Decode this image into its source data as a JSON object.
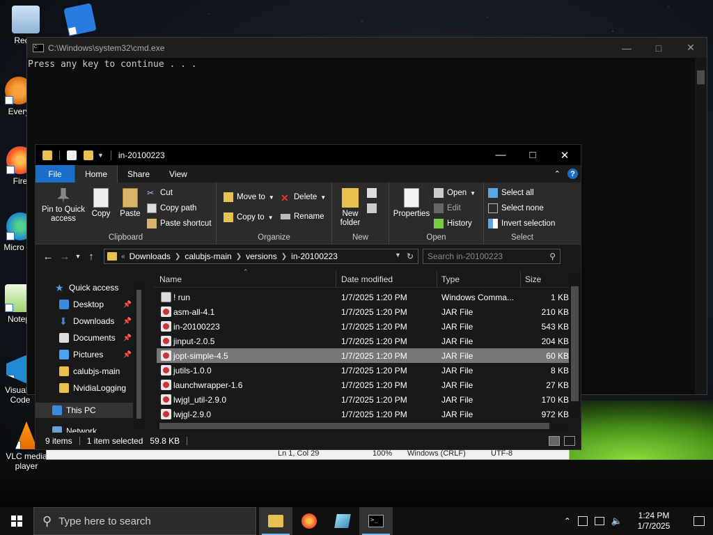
{
  "desktop": {
    "icons": [
      {
        "label": "Recyc"
      },
      {
        "label": "Every"
      },
      {
        "label": "Fire"
      },
      {
        "label": "Micro Ed"
      },
      {
        "label": "Notep"
      },
      {
        "label": "Visual S Code"
      },
      {
        "label": "VLC media player"
      }
    ]
  },
  "cmd": {
    "title": "C:\\Windows\\system32\\cmd.exe",
    "output": "Press any key to continue . . ."
  },
  "notepad_status": {
    "position": "Ln 1, Col 29",
    "zoom": "100%",
    "line_ending": "Windows (CRLF)",
    "encoding": "UTF-8"
  },
  "explorer": {
    "title": "in-20100223",
    "tabs": {
      "file": "File",
      "home": "Home",
      "share": "Share",
      "view": "View"
    },
    "ribbon": {
      "clipboard": {
        "label": "Clipboard",
        "pin": "Pin to Quick access",
        "copy": "Copy",
        "paste": "Paste",
        "cut": "Cut",
        "copy_path": "Copy path",
        "paste_shortcut": "Paste shortcut"
      },
      "organize": {
        "label": "Organize",
        "move_to": "Move to",
        "copy_to": "Copy to",
        "delete": "Delete",
        "rename": "Rename"
      },
      "new": {
        "label": "New",
        "new_folder": "New folder"
      },
      "open": {
        "label": "Open",
        "properties": "Properties",
        "open": "Open",
        "edit": "Edit",
        "history": "History"
      },
      "select": {
        "label": "Select",
        "select_all": "Select all",
        "select_none": "Select none",
        "invert": "Invert selection"
      }
    },
    "address": {
      "prefix": "«",
      "crumbs": [
        "Downloads",
        "calubjs-main",
        "versions",
        "in-20100223"
      ]
    },
    "search_placeholder": "Search in-20100223",
    "nav": [
      {
        "label": "Quick access",
        "pinned": false
      },
      {
        "label": "Desktop",
        "pinned": true
      },
      {
        "label": "Downloads",
        "pinned": true
      },
      {
        "label": "Documents",
        "pinned": true
      },
      {
        "label": "Pictures",
        "pinned": true
      },
      {
        "label": "calubjs-main",
        "pinned": false
      },
      {
        "label": "NvidiaLogging",
        "pinned": false
      },
      {
        "label": "This PC",
        "pinned": false
      },
      {
        "label": "Network",
        "pinned": false
      }
    ],
    "columns": {
      "name": "Name",
      "date": "Date modified",
      "type": "Type",
      "size": "Size"
    },
    "files": [
      {
        "name": "! run",
        "date": "1/7/2025 1:20 PM",
        "type": "Windows Comma...",
        "size": "1 KB",
        "kind": "bat"
      },
      {
        "name": "asm-all-4.1",
        "date": "1/7/2025 1:20 PM",
        "type": "JAR File",
        "size": "210 KB",
        "kind": "jar"
      },
      {
        "name": "in-20100223",
        "date": "1/7/2025 1:20 PM",
        "type": "JAR File",
        "size": "543 KB",
        "kind": "jar"
      },
      {
        "name": "jinput-2.0.5",
        "date": "1/7/2025 1:20 PM",
        "type": "JAR File",
        "size": "204 KB",
        "kind": "jar"
      },
      {
        "name": "jopt-simple-4.5",
        "date": "1/7/2025 1:20 PM",
        "type": "JAR File",
        "size": "60 KB",
        "kind": "jar",
        "selected": true
      },
      {
        "name": "jutils-1.0.0",
        "date": "1/7/2025 1:20 PM",
        "type": "JAR File",
        "size": "8 KB",
        "kind": "jar"
      },
      {
        "name": "launchwrapper-1.6",
        "date": "1/7/2025 1:20 PM",
        "type": "JAR File",
        "size": "27 KB",
        "kind": "jar"
      },
      {
        "name": "lwjgl_util-2.9.0",
        "date": "1/7/2025 1:20 PM",
        "type": "JAR File",
        "size": "170 KB",
        "kind": "jar"
      },
      {
        "name": "lwjgl-2.9.0",
        "date": "1/7/2025 1:20 PM",
        "type": "JAR File",
        "size": "972 KB",
        "kind": "jar"
      }
    ],
    "status": {
      "count": "9 items",
      "selected": "1 item selected",
      "size": "59.8 KB"
    }
  },
  "taskbar": {
    "search_placeholder": "Type here to search",
    "time": "1:24 PM",
    "date": "1/7/2025"
  },
  "colors": {
    "accent": "#1a6ec8",
    "folder": "#e8c050",
    "selection": "#777777"
  }
}
